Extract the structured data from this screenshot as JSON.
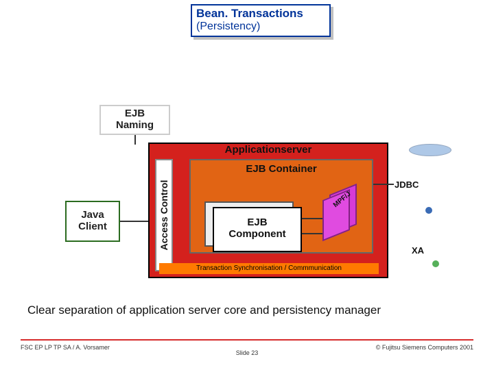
{
  "title": {
    "line1": "Bean. Transactions",
    "line2": "(Persistency)"
  },
  "boxes": {
    "ejb_naming_l1": "EJB",
    "ejb_naming_l2": "Naming",
    "appserver": "Applicationserver",
    "access_control": "Access Control",
    "ejb_container": "EJB Container",
    "ejb_component_l1": "EJB",
    "ejb_component_l2": "Component",
    "java_client_l1": "Java",
    "java_client_l2": "Client",
    "mpfli": "MPF/J",
    "sync_bar": "Transaction Synchronisation / Commmunication"
  },
  "labels": {
    "jdbc": "JDBC",
    "xa": "XA"
  },
  "caption": "Clear separation of application server core and persistency manager",
  "footer": {
    "left": "FSC EP LP TP SA / A. Vorsamer",
    "center": "Slide 23",
    "right": "© Fujitsu Siemens Computers 2001"
  }
}
